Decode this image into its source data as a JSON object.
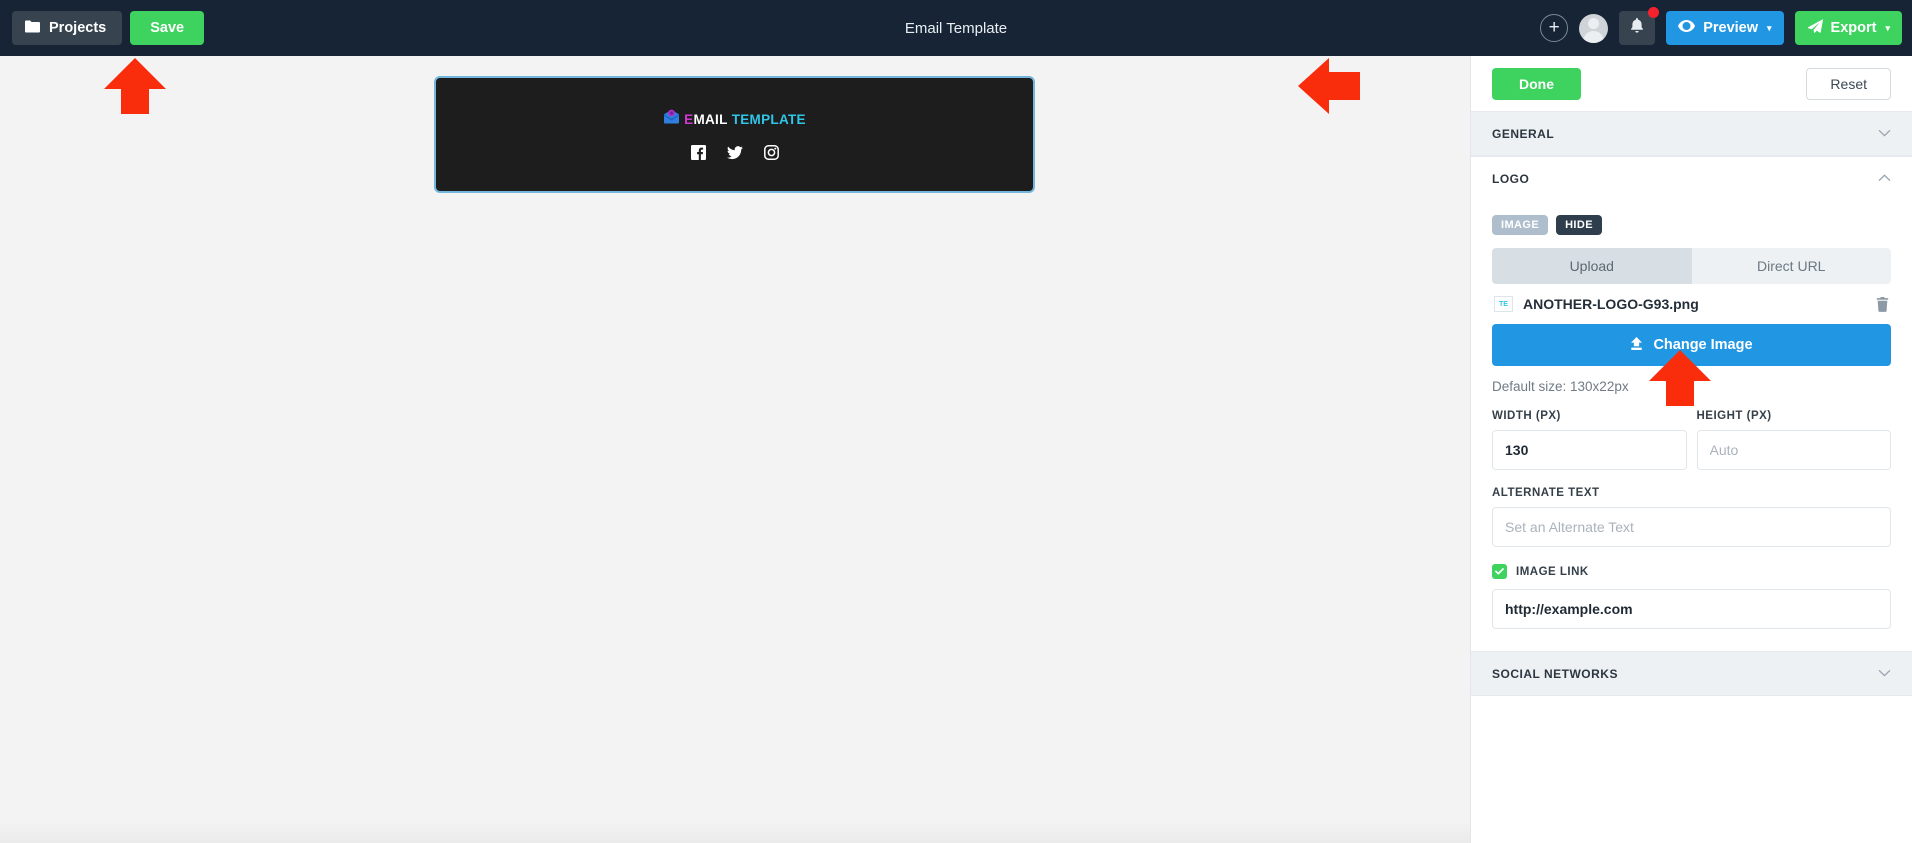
{
  "topbar": {
    "projects_label": "Projects",
    "save_label": "Save",
    "title": "Email Template",
    "preview_label": "Preview",
    "export_label": "Export",
    "add_icon": "plus-icon",
    "avatar_icon": "user-avatar-icon",
    "bell_icon": "notification-bell-icon",
    "preview_icon": "eye-icon",
    "export_icon": "share-arrow-icon",
    "caret": "▾"
  },
  "canvas": {
    "email_logo": {
      "icon": "email-envelope-icon",
      "part1": "E",
      "part2": "MAIL",
      "part3": "TEMPLATE"
    },
    "socials": [
      {
        "name": "facebook-icon",
        "label": "Facebook"
      },
      {
        "name": "twitter-icon",
        "label": "Twitter"
      },
      {
        "name": "instagram-icon",
        "label": "Instagram"
      }
    ]
  },
  "panel": {
    "done_label": "Done",
    "reset_label": "Reset",
    "sections": {
      "general": {
        "title": "GENERAL",
        "state": "collapsed",
        "chevron": "⌄"
      },
      "logo": {
        "title": "LOGO",
        "state": "open",
        "chevron": "⌃"
      },
      "social": {
        "title": "SOCIAL NETWORKS",
        "state": "collapsed",
        "chevron": "⌄"
      }
    },
    "logo": {
      "badge_image": "IMAGE",
      "badge_hide": "HIDE",
      "tab_upload": "Upload",
      "tab_direct_url": "Direct URL",
      "file_name": "ANOTHER-LOGO-G93.png",
      "file_thumb_text": "TE",
      "change_image_label": "Change Image",
      "default_size": "Default size: 130x22px",
      "width_label": "WIDTH (PX)",
      "width_value": "130",
      "height_label": "HEIGHT (PX)",
      "height_value": "",
      "height_placeholder": "Auto",
      "alt_label": "ALTERNATE TEXT",
      "alt_value": "",
      "alt_placeholder": "Set an Alternate Text",
      "image_link_label": "IMAGE LINK",
      "image_link_checked": true,
      "image_link_value": "http://example.com"
    }
  },
  "annotations": [
    {
      "name": "arrow-pointing-to-save",
      "direction": "up",
      "color": "#f92c0c"
    },
    {
      "name": "arrow-pointing-to-done",
      "direction": "left",
      "color": "#f92c0c"
    },
    {
      "name": "arrow-pointing-to-change-image",
      "direction": "up",
      "color": "#f92c0c"
    }
  ],
  "colors": {
    "topbar_bg": "#172435",
    "accent_green": "#3ed35f",
    "accent_blue": "#2196e3",
    "canvas_bg": "#f3f3f3",
    "email_bg": "#1d1d1d",
    "selection_border": "#73b6dd",
    "arrow_red": "#f92c0c"
  }
}
